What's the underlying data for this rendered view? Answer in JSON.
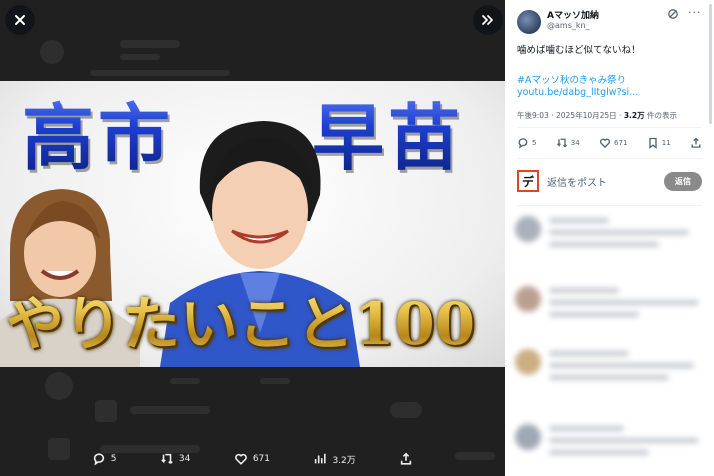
{
  "viewer": {
    "close_icon": "close-icon",
    "expand_icon": "double-chevron-right-icon",
    "thumbnail": {
      "title_left": "高市",
      "title_right": "早苗",
      "caption": "やりたいこと100"
    },
    "actions": [
      {
        "icon": "reply-icon",
        "count": "5"
      },
      {
        "icon": "repost-icon",
        "count": "34"
      },
      {
        "icon": "like-icon",
        "count": "671"
      },
      {
        "icon": "views-icon",
        "count": "3.2万"
      },
      {
        "icon": "share-icon",
        "count": ""
      }
    ]
  },
  "post": {
    "author_name": "Aマッソ加納",
    "handle": "@ams_kn_",
    "text": "噛めば噛むほど似てないね！",
    "hashtag": "#Aマッソ秋のきゃみ祭り",
    "link": "youtu.be/dabg_lItglw?si...",
    "meta_time": "午後9:03 · 2025年10月25日 · ",
    "meta_views": "3.2万",
    "meta_views_suffix": " 件の表示",
    "actions": {
      "replies": "5",
      "reposts": "34",
      "likes": "671",
      "bookmarks": "11"
    },
    "reply_avatar_char": "デ",
    "reply_placeholder": "返信をポスト",
    "reply_button": "返信"
  },
  "colors": {
    "accent": "#1d9bf0",
    "title_blue": "#1c3fd0",
    "gold": "#e8c24a",
    "reply_button_bg": "#8a8a8a"
  }
}
